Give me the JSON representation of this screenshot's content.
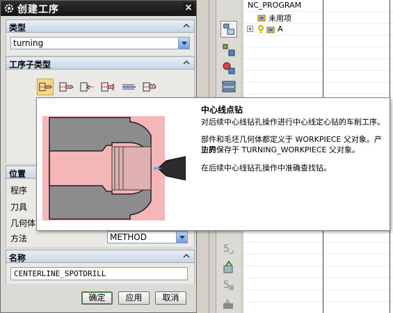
{
  "dialog": {
    "title": "创建工序",
    "type_section": {
      "header": "类型",
      "selected": "turning"
    },
    "subtype_section": {
      "header": "工序子类型",
      "icons": [
        "centerline-spotdrill-icon",
        "centerline-drill-icon",
        "centerline-peckdrill-icon",
        "centerline-breakchip-icon",
        "centerline-ream-icon",
        "centerline-tapping-icon"
      ]
    },
    "location_section": {
      "header": "位置",
      "labels": {
        "program": "程序",
        "tool": "刀具",
        "geometry": "几何体",
        "method": "方法"
      },
      "method_value": "METHOD"
    },
    "name_section": {
      "header": "名称",
      "value": "CENTERLINE_SPOTDRILL"
    },
    "buttons": {
      "ok": "确定",
      "apply": "应用",
      "cancel": "取消"
    }
  },
  "tooltip": {
    "title": "中心线点钻",
    "p1": "对后续中心线钻孔操作进行中心线定心钻的车削工序。",
    "p2a": "部件和毛坯几何体都定义于 WORKPIECE 父对象。产生的",
    "p2b": "边界保存于 TURNING_WORKPIECE 父对象。",
    "p3": "在后续中心线钻孔操作中准确查找钻。"
  },
  "navigator": {
    "root": "NC_PROGRAM",
    "items": [
      {
        "label": "未用项",
        "icon": "program-group-icon"
      },
      {
        "label": "A",
        "icon": "program-group-icon"
      }
    ]
  },
  "colors": {
    "title_bar": "#1f1f1f",
    "section_header": "#d5e0ee",
    "illustration_pink": "#f4b6b6",
    "ok_border": "#3b8c3b"
  }
}
